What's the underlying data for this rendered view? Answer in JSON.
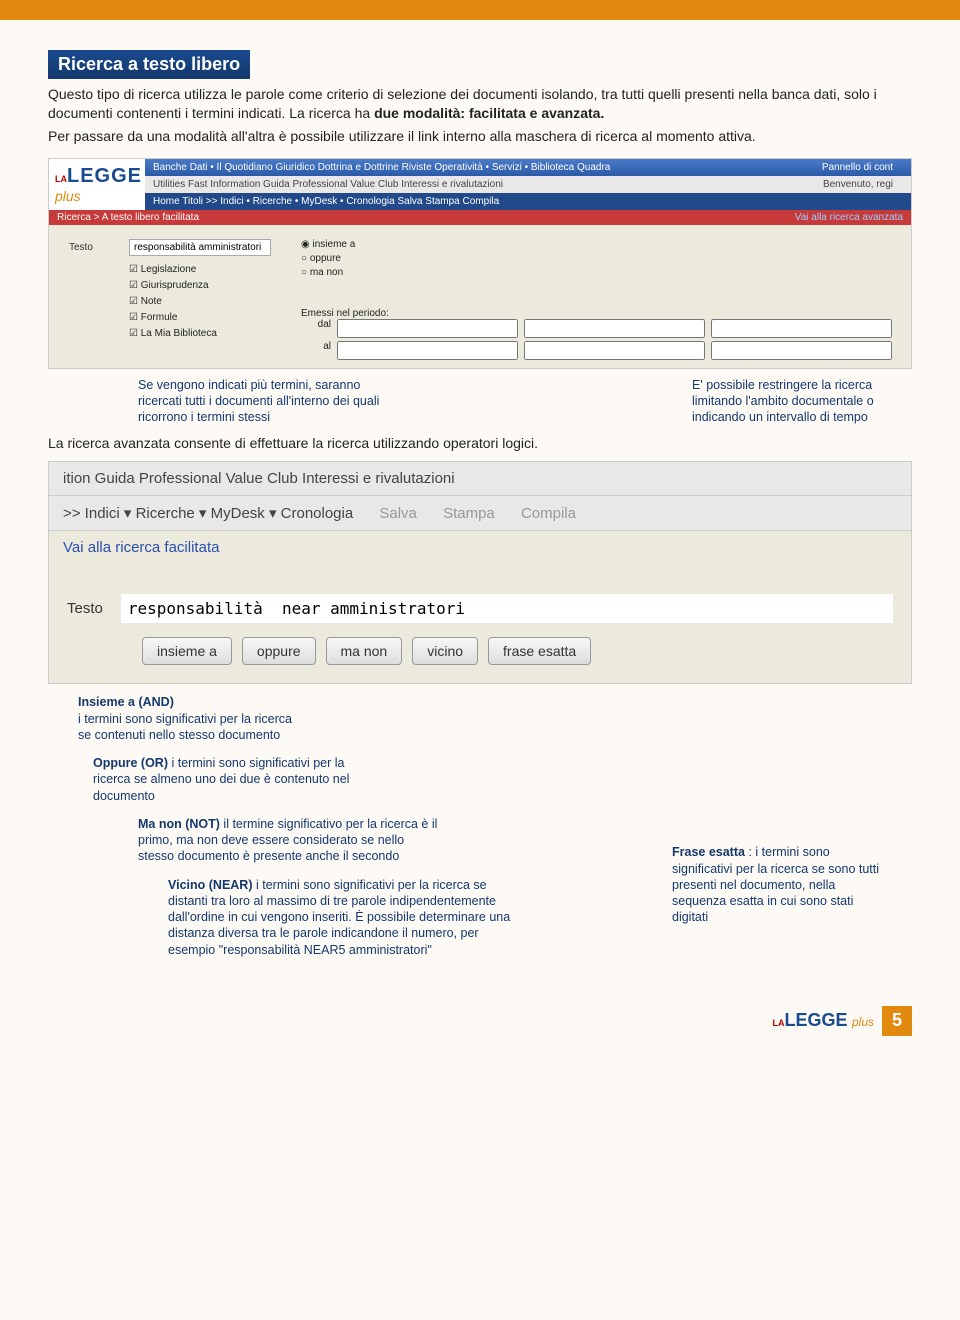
{
  "section_title": "Ricerca a testo libero",
  "intro1": "Questo tipo di ricerca utilizza le parole come criterio di selezione dei documenti isolando, tra tutti quelli presenti nella banca dati, solo i documenti contenenti i termini indicati. La ricerca ha ",
  "intro1_bold": "due modalità: facilitata e avanzata.",
  "intro2": "Per passare da una modalità all'altra è possibile utilizzare il link interno alla maschera di ricerca al momento attiva.",
  "logo_la": "LA",
  "logo_legge": "LEGGE",
  "logo_plus": "plus",
  "shot1": {
    "blue_items_left": "Banche Dati •   Il Quotidiano Giuridico   Dottrina e Dottrine   Riviste   Operatività •   Servizi •   Biblioteca   Quadra",
    "blue_right": "Pannello di cont",
    "gray_items_left": "Utilities   Fast Information   Guida   Professional Value Club   Interessi e rivalutazioni",
    "gray_right": "Benvenuto, regi",
    "darkblue_items": "Home   Titoli   >>   Indici •   Ricerche •   MyDesk •   Cronologia   Salva   Stampa   Compila",
    "crumb": "Ricerca > A testo libero facilitata",
    "crumb_link": "Vai alla ricerca avanzata",
    "testo_label": "Testo",
    "testo_value": "responsabilità amministratori",
    "radio1": "insieme a",
    "radio2": "oppure",
    "radio3": "ma non",
    "checks": [
      "Legislazione",
      "Giurisprudenza",
      "Note",
      "Formule",
      "La Mia Biblioteca"
    ],
    "period_label": "Emessi nel periodo:",
    "dal": "dal",
    "al": "al"
  },
  "callout1": "Se vengono indicati più termini, saranno ricercati tutti i documenti all'interno dei quali ricorrono i termini stessi",
  "callout2": "E' possibile restringere la ricerca limitando l'ambito documentale o indicando un intervallo di tempo",
  "subhead": "La ricerca avanzata consente di effettuare la ricerca utilizzando operatori logici.",
  "shot2": {
    "bar1": "ition   Guida   Professional Value Club   Interessi e rivalutazioni",
    "bar2_left": ">>   Indici ▾   Ricerche ▾   MyDesk ▾   Cronologia",
    "bar2_right_salva": "Salva",
    "bar2_right_stampa": "Stampa",
    "bar2_right_compila": "Compila",
    "link": "Vai alla ricerca facilitata",
    "testo_label": "Testo",
    "testo_value": "responsabilità  near amministratori",
    "buttons": [
      "insieme a",
      "oppure",
      "ma non",
      "vicino",
      "frase esatta"
    ]
  },
  "ops": {
    "o1_h": "Insieme a (AND)",
    "o1_t": " i termini sono significativi per la ricerca se contenuti nello stesso documento",
    "o2_h": "Oppure (OR)",
    "o2_t": " i termini sono significativi per la ricerca se almeno uno dei due è contenuto nel documento",
    "o3_h": "Ma non (NOT)",
    "o3_t": " il termine significativo per la ricerca è il primo, ma non deve essere considerato se nello stesso documento è presente anche il secondo",
    "o4_h": "Vicino (NEAR)",
    "o4_t": " i termini sono significativi per la ricerca se distanti tra loro al massimo di tre parole indipendentemente dall'ordine in cui vengono inseriti. È possibile determinare una distanza diversa tra le parole indicandone il numero, per esempio \"responsabilità NEAR5 amministratori\"",
    "o5_h": "Frase esatta",
    "o5_t": ": i termini sono significativi per la ricerca se sono tutti presenti nel documento, nella sequenza esatta in cui sono stati digitati"
  },
  "page_number": "5"
}
